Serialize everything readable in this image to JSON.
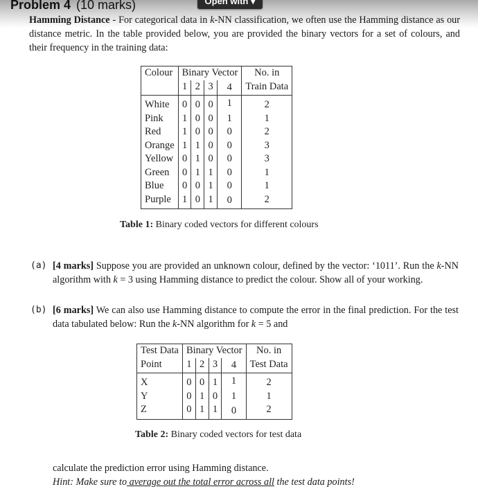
{
  "viewer": {
    "open_with_label": "Open with ▾"
  },
  "problem": {
    "number_label": "Problem 4",
    "marks_label": "(10 marks)",
    "intro": {
      "term": "Hamming Distance",
      "text_1": " - For categorical data in ",
      "k": "k",
      "text_2": "-NN classification, we often use the Hamming distance as our distance metric. In the table provided below, you are provided the binary vectors for a set of colours, and their frequency in the training data:"
    }
  },
  "table1": {
    "headers": {
      "colour": "Colour",
      "binary_vector": "Binary Vector",
      "bits": [
        "1",
        "2",
        "3",
        "4"
      ],
      "count_line1": "No. in",
      "count_line2": "Train Data"
    },
    "rows": [
      {
        "name": "White",
        "bits": [
          "0",
          "0",
          "0",
          "1"
        ],
        "count": "2"
      },
      {
        "name": "Pink",
        "bits": [
          "1",
          "0",
          "0",
          "1"
        ],
        "count": "1"
      },
      {
        "name": "Red",
        "bits": [
          "1",
          "0",
          "0",
          "0"
        ],
        "count": "2"
      },
      {
        "name": "Orange",
        "bits": [
          "1",
          "1",
          "0",
          "0"
        ],
        "count": "3"
      },
      {
        "name": "Yellow",
        "bits": [
          "0",
          "1",
          "0",
          "0"
        ],
        "count": "3"
      },
      {
        "name": "Green",
        "bits": [
          "0",
          "1",
          "1",
          "0"
        ],
        "count": "1"
      },
      {
        "name": "Blue",
        "bits": [
          "0",
          "0",
          "1",
          "0"
        ],
        "count": "1"
      },
      {
        "name": "Purple",
        "bits": [
          "1",
          "0",
          "1",
          "0"
        ],
        "count": "2"
      }
    ],
    "caption_label": "Table 1:",
    "caption_text": " Binary coded vectors for different colours"
  },
  "part_a": {
    "label": "(a)",
    "marks": "[4 marks]",
    "text_1": " Suppose you are provided an unknown colour, defined by the vector: ‘1011’. Run the ",
    "k": "k",
    "text_2": "-NN algorithm with ",
    "k2": "k",
    "text_3": " = 3 using Hamming distance to predict the colour. Show all of your working."
  },
  "part_b": {
    "label": "(b)",
    "marks": "[6 marks]",
    "text_1": " We can also use Hamming distance to compute the error in the final prediction. For the test data tabulated below: Run the ",
    "k": "k",
    "text_2": "-NN algorithm for ",
    "k2": "k",
    "text_3": " = 5 and",
    "text_after": "calculate the prediction error using Hamming distance.",
    "hint_prefix": "Hint: Make sure to",
    "hint_underlined": " average out the total error across all",
    "hint_suffix": " the test data points!"
  },
  "table2": {
    "headers": {
      "point_line1": "Test Data",
      "point_line2": "Point",
      "binary_vector": "Binary Vector",
      "bits": [
        "1",
        "2",
        "3",
        "4"
      ],
      "count_line1": "No. in",
      "count_line2": "Test Data"
    },
    "rows": [
      {
        "name": "X",
        "bits": [
          "0",
          "0",
          "1",
          "1"
        ],
        "count": "2"
      },
      {
        "name": "Y",
        "bits": [
          "0",
          "1",
          "0",
          "1"
        ],
        "count": "1"
      },
      {
        "name": "Z",
        "bits": [
          "0",
          "1",
          "1",
          "0"
        ],
        "count": "2"
      }
    ],
    "caption_label": "Table 2:",
    "caption_text": " Binary coded vectors for test data"
  }
}
